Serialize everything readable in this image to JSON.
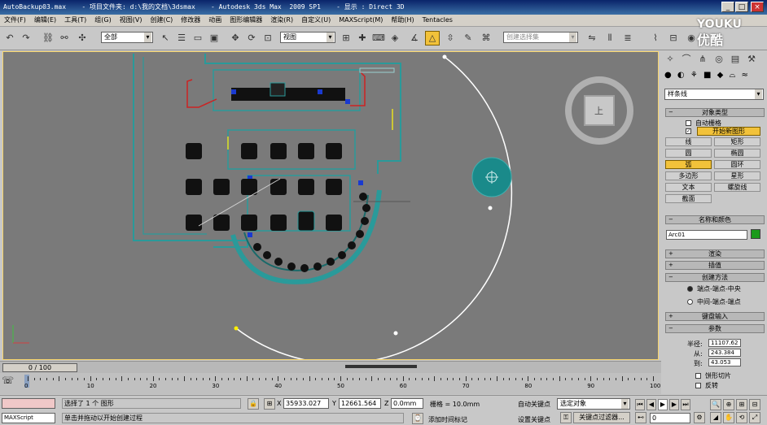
{
  "titlebar": {
    "text": "AutoBackup03.max    - 项目文件夹: d:\\我的文档\\3dsmax    - Autodesk 3ds Max  2009 SP1    - 显示 : Direct 3D",
    "min": "_",
    "max": "□",
    "close": "×"
  },
  "menu": [
    "文件(F)",
    "编辑(E)",
    "工具(T)",
    "组(G)",
    "视图(V)",
    "创建(C)",
    "修改器",
    "动画",
    "图形编辑器",
    "渲染(R)",
    "自定义(U)",
    "MAXScript(M)",
    "帮助(H)",
    "Tentacles"
  ],
  "toolbar": {
    "selection_filter": "全部",
    "ref_coord": "视图",
    "named_selection": "创建选择集"
  },
  "viewport": {
    "label": "",
    "viewcube_face": "上",
    "colors": {
      "bg": "#7a7a7a",
      "walls": "#2a9a9a",
      "selected_circle": "#1a8a8a",
      "arc": "#ffffff",
      "furniture": "#111111"
    }
  },
  "watermark": {
    "line1": "YOUKU",
    "line2": "优酷"
  },
  "command_panel": {
    "category": "样条线",
    "object_type_header": "对象类型",
    "auto_grid": "自动栅格",
    "start_new_shape": "开始新图形",
    "buttons": [
      [
        "线",
        "矩形"
      ],
      [
        "圆",
        "椭圆"
      ],
      [
        "弧",
        "圆环"
      ],
      [
        "多边形",
        "星形"
      ],
      [
        "文本",
        "螺旋线"
      ],
      [
        "截面",
        ""
      ]
    ],
    "active_button": "弧",
    "name_color_header": "名称和颜色",
    "object_name": "Arc01",
    "object_color": "#1a9a1a",
    "rendering": "渲染",
    "interpolation": "插值",
    "creation_method": "创建方法",
    "method_options": [
      "端点-端点-中央",
      "中间-端点-端点"
    ],
    "keyboard_entry": "键盘输入",
    "parameters": "参数",
    "radius_label": "半径:",
    "radius_value": "11107.62",
    "from_label": "从:",
    "from_value": "243.384",
    "to_label": "到:",
    "to_value": "43.053",
    "pie_slice": "饼形切片",
    "reverse": "反转"
  },
  "timeline": {
    "frame": "0 / 100",
    "ticks": [
      "0",
      "10",
      "20",
      "30",
      "40",
      "50",
      "60",
      "70",
      "80",
      "90",
      "100"
    ]
  },
  "status": {
    "maxscript": "MAXScript",
    "selected": "选择了 1 个 图形",
    "prompt": "单击并拖动以开始创建过程",
    "x": "35933.027",
    "y": "12661.564",
    "z": "0.0mm",
    "grid": "栅格 = 10.0mm",
    "add_time_tag": "添加时间标记",
    "auto_key": "自动关键点",
    "selected_obj": "选定对象",
    "set_key": "设置关键点",
    "key_filters": "关键点过滤器...",
    "frame_field": "0"
  }
}
